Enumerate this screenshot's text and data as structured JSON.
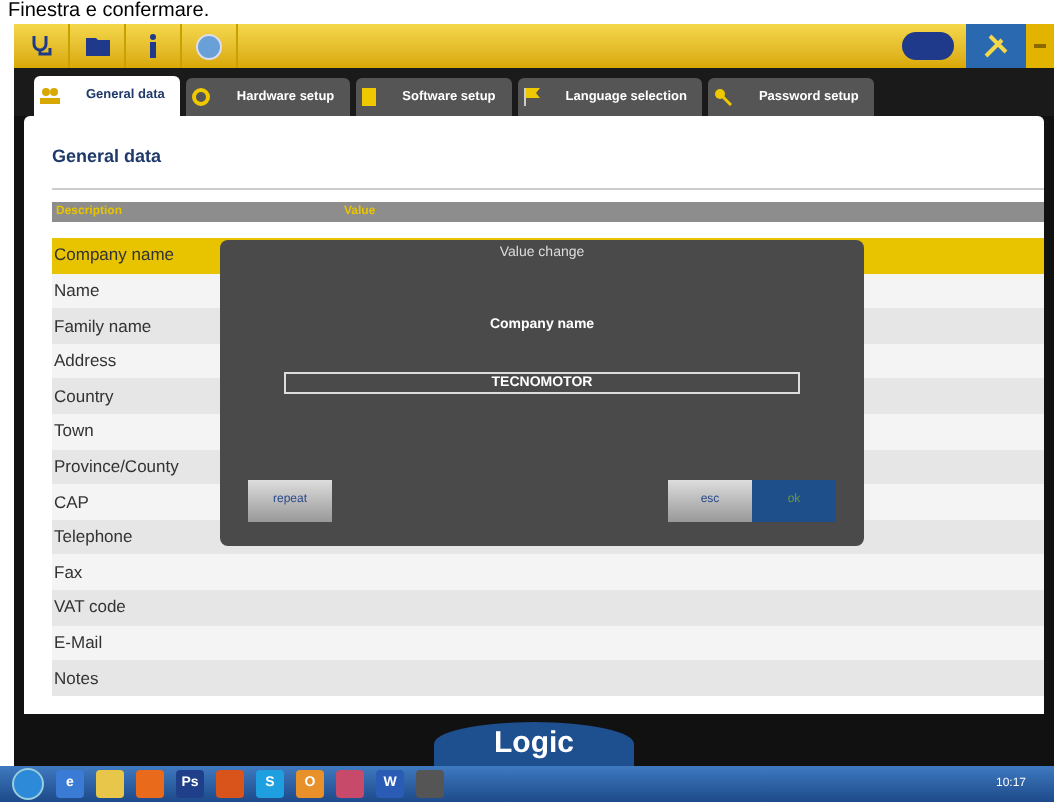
{
  "caption": "Finestra e confermare.",
  "tabs": [
    {
      "label": "General data",
      "selected": true
    },
    {
      "label": "Hardware setup",
      "selected": false
    },
    {
      "label": "Software setup",
      "selected": false
    },
    {
      "label": "Language selection",
      "selected": false
    },
    {
      "label": "Password setup",
      "selected": false
    }
  ],
  "panel_title": "General data",
  "table": {
    "columns": [
      "Description",
      "Value"
    ],
    "rows": [
      {
        "label": "Company name",
        "selected": true
      },
      {
        "label": "Name",
        "selected": false
      },
      {
        "label": "Family name",
        "selected": false
      },
      {
        "label": "Address",
        "selected": false
      },
      {
        "label": "Country",
        "selected": false
      },
      {
        "label": "Town",
        "selected": false
      },
      {
        "label": "Province/County",
        "selected": false
      },
      {
        "label": "CAP",
        "selected": false
      },
      {
        "label": "Telephone",
        "selected": false
      },
      {
        "label": "Fax",
        "selected": false
      },
      {
        "label": "VAT code",
        "selected": false
      },
      {
        "label": "E-Mail",
        "selected": false
      },
      {
        "label": "Notes",
        "selected": false
      }
    ]
  },
  "dialog": {
    "title": "Value change",
    "field_label": "Company name",
    "value": "TECNOMOTOR",
    "buttons": [
      "repeat",
      "esc",
      "ok"
    ]
  },
  "brand_bar": {
    "label": "Logic"
  },
  "taskbar": {
    "items": [
      {
        "kind": "app",
        "label": "e"
      },
      {
        "kind": "app"
      },
      {
        "kind": "app"
      },
      {
        "kind": "app",
        "label": "Ps"
      },
      {
        "kind": "app"
      },
      {
        "kind": "app",
        "label": "S"
      },
      {
        "kind": "app",
        "label": "O"
      },
      {
        "kind": "app"
      },
      {
        "kind": "app",
        "label": "W"
      },
      {
        "kind": "app"
      }
    ],
    "clock": "10:17"
  }
}
